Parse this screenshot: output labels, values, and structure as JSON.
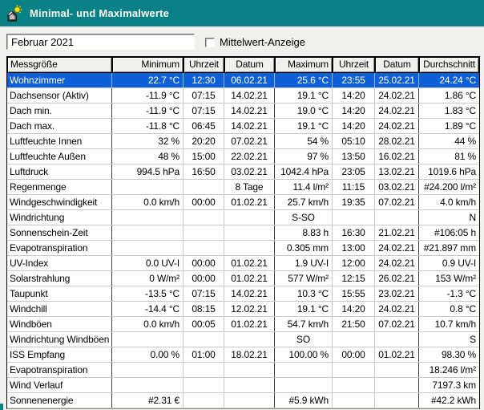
{
  "window": {
    "title": "Minimal- und Maximalwerte"
  },
  "controls": {
    "month_value": "Februar 2021",
    "mittelwert_label": "Mittelwert-Anzeige",
    "mittelwert_checked": false
  },
  "icons": {
    "app_icon": "weather-station-with-sun-icon"
  },
  "colors": {
    "titlebar": "#0a8184",
    "window_bg": "#f0f0ec",
    "selection": "#0e60d8",
    "grid_line": "#c9c9c9",
    "group_line": "#3c3c3c",
    "sun_yellow": "#f8e400"
  },
  "table": {
    "headers": [
      "Messgröße",
      "Minimum",
      "Uhrzeit",
      "Datum",
      "Maximum",
      "Uhrzeit",
      "Datum",
      "Durchschnitt"
    ],
    "selected_row": 0,
    "rows": [
      [
        "Wohnzimmer",
        "22.7 °C",
        "12:30",
        "06.02.21",
        "25.6 °C",
        "23:55",
        "25.02.21",
        "24.24 °C"
      ],
      [
        "Dachsensor (Aktiv)",
        "-11.9 °C",
        "07:15",
        "14.02.21",
        "19.1 °C",
        "14:20",
        "24.02.21",
        "1.86 °C"
      ],
      [
        "Dach min.",
        "-11.9 °C",
        "07:15",
        "14.02.21",
        "19.0 °C",
        "14:20",
        "24.02.21",
        "1.83 °C"
      ],
      [
        "Dach max.",
        "-11.8 °C",
        "06:45",
        "14.02.21",
        "19.1 °C",
        "14:20",
        "24.02.21",
        "1.89 °C"
      ],
      [
        "Luftfeuchte Innen",
        "32 %",
        "20:20",
        "07.02.21",
        "54 %",
        "05:10",
        "28.02.21",
        "44 %"
      ],
      [
        "Luftfeuchte Außen",
        "48 %",
        "15:00",
        "22.02.21",
        "97 %",
        "13:50",
        "16.02.21",
        "81 %"
      ],
      [
        "Luftdruck",
        "994.5 hPa",
        "16:50",
        "03.02.21",
        "1042.4 hPa",
        "23:05",
        "13.02.21",
        "1019.6 hPa"
      ],
      [
        "Regenmenge",
        "",
        "",
        "8 Tage",
        "11.4 l/m²",
        "11:15",
        "03.02.21",
        "#24.200 l/m²"
      ],
      [
        "Windgeschwindigkeit",
        "0.0 km/h",
        "00:00",
        "01.02.21",
        "25.7 km/h",
        "19:35",
        "07.02.21",
        "4.0 km/h"
      ],
      [
        "Windrichtung",
        "",
        "",
        "",
        "S-SO",
        "",
        "",
        "N"
      ],
      [
        "Sonnenschein-Zeit",
        "",
        "",
        "",
        "8.83 h",
        "16:30",
        "21.02.21",
        "#106:05 h"
      ],
      [
        "Evapotranspiration",
        "",
        "",
        "",
        "0.305 mm",
        "13:00",
        "24.02.21",
        "#21.897 mm"
      ],
      [
        "UV-Index",
        "0.0 UV-I",
        "00:00",
        "01.02.21",
        "1.9 UV-I",
        "12:00",
        "24.02.21",
        "0.9 UV-I"
      ],
      [
        "Solarstrahlung",
        "0 W/m²",
        "00:00",
        "01.02.21",
        "577 W/m²",
        "12:15",
        "26.02.21",
        "153 W/m²"
      ],
      [
        "Taupunkt",
        "-13.5 °C",
        "07:15",
        "14.02.21",
        "10.3 °C",
        "15:55",
        "23.02.21",
        "-1.3 °C"
      ],
      [
        "Windchill",
        "-14.4 °C",
        "08:15",
        "12.02.21",
        "19.1 °C",
        "14:20",
        "24.02.21",
        "0.8 °C"
      ],
      [
        "Windböen",
        "0.0 km/h",
        "00:05",
        "01.02.21",
        "54.7 km/h",
        "21:50",
        "07.02.21",
        "10.7 km/h"
      ],
      [
        "Windrichtung Windböen",
        "",
        "",
        "",
        "SO",
        "",
        "",
        "S"
      ],
      [
        "ISS Empfang",
        "0.00 %",
        "01:00",
        "18.02.21",
        "100.00 %",
        "00:00",
        "01.02.21",
        "98.30 %"
      ],
      [
        "Evapotranspiration",
        "",
        "",
        "",
        "",
        "",
        "",
        "18.246 l/m²"
      ],
      [
        "Wind Verlauf",
        "",
        "",
        "",
        "",
        "",
        "",
        "7197.3 km"
      ],
      [
        "Sonnenenergie",
        "#2.31 €",
        "",
        "",
        "#5.9 kWh",
        "",
        "",
        "#42.2 kWh"
      ]
    ]
  }
}
